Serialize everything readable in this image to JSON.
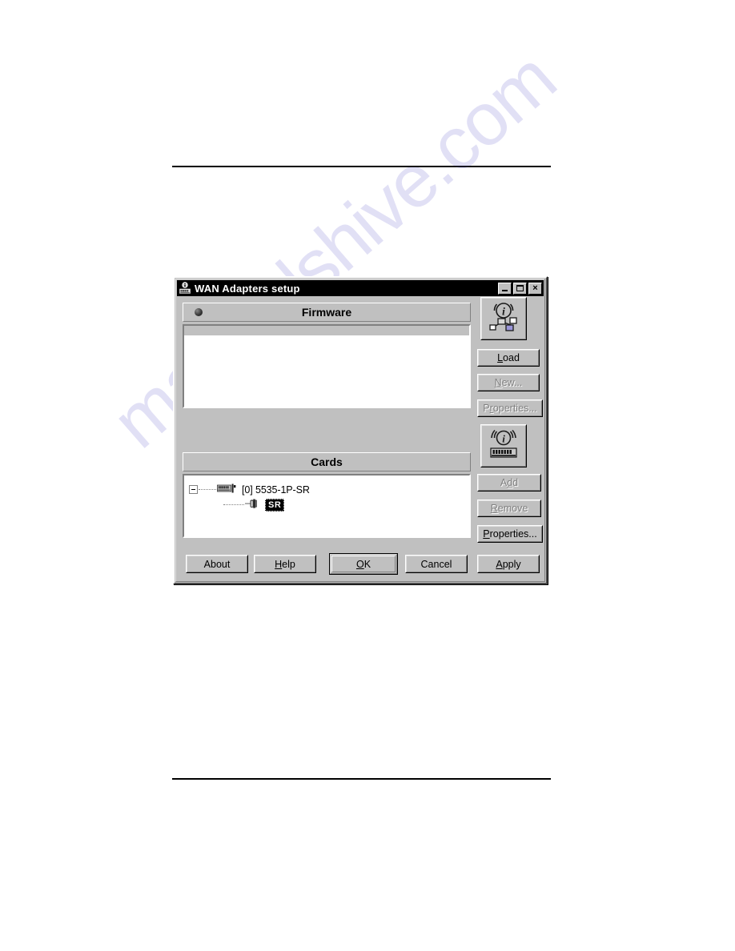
{
  "page": {
    "watermark_text": "manualshive.com"
  },
  "window": {
    "title": "WAN Adapters setup",
    "title_icon": "adapter-card-icon",
    "caption_buttons": [
      {
        "name": "minimize-button",
        "label": "_",
        "icon": "minimize-icon"
      },
      {
        "name": "maximize-button",
        "label": "□",
        "icon": "maximize-icon"
      },
      {
        "name": "close-button",
        "label": "×",
        "icon": "close-icon"
      }
    ]
  },
  "firmware_section": {
    "header_title": "Firmware",
    "header_icon": "sphere-bullet-icon",
    "items": []
  },
  "cards_section": {
    "header_title": "Cards",
    "tree": [
      {
        "label": "[0] 5535-1P-SR",
        "icon": "adapter-card-icon",
        "expanded": true,
        "selected": false,
        "children": [
          {
            "label": "SR",
            "icon": "port-connector-icon",
            "selected": true
          }
        ]
      }
    ]
  },
  "side_buttons": {
    "firmware_info_icon": "info-network-icon",
    "cards_info_icon": "info-adapter-icon",
    "load": {
      "label": "Load",
      "accel": "L",
      "enabled": true
    },
    "new": {
      "label": "New...",
      "accel": "N",
      "enabled": false
    },
    "firmware_properties": {
      "label": "Properties...",
      "accel": "r",
      "enabled": false
    },
    "add": {
      "label": "Add",
      "accel": "d",
      "enabled": false
    },
    "remove": {
      "label": "Remove",
      "accel": "R",
      "enabled": false
    },
    "card_properties": {
      "label": "Properties...",
      "accel": "P",
      "enabled": true
    }
  },
  "bottom_buttons": [
    {
      "name": "about-button",
      "label": "About",
      "accel": "",
      "enabled": true,
      "default": false
    },
    {
      "name": "help-button",
      "label": "Help",
      "accel": "H",
      "enabled": true,
      "default": false
    },
    {
      "name": "ok-button",
      "label": "OK",
      "accel": "O",
      "enabled": true,
      "default": true
    },
    {
      "name": "cancel-button",
      "label": "Cancel",
      "accel": "",
      "enabled": true,
      "default": false
    },
    {
      "name": "apply-button",
      "label": "Apply",
      "accel": "A",
      "enabled": true,
      "default": false
    }
  ],
  "colors": {
    "face": "#c0c0c0",
    "shadow": "#808080",
    "highlight": "#ffffff",
    "text": "#000000",
    "disabled_text": "#808080",
    "titlebar": "#000000",
    "selection": "#000000",
    "watermark": "#4a44c8"
  }
}
